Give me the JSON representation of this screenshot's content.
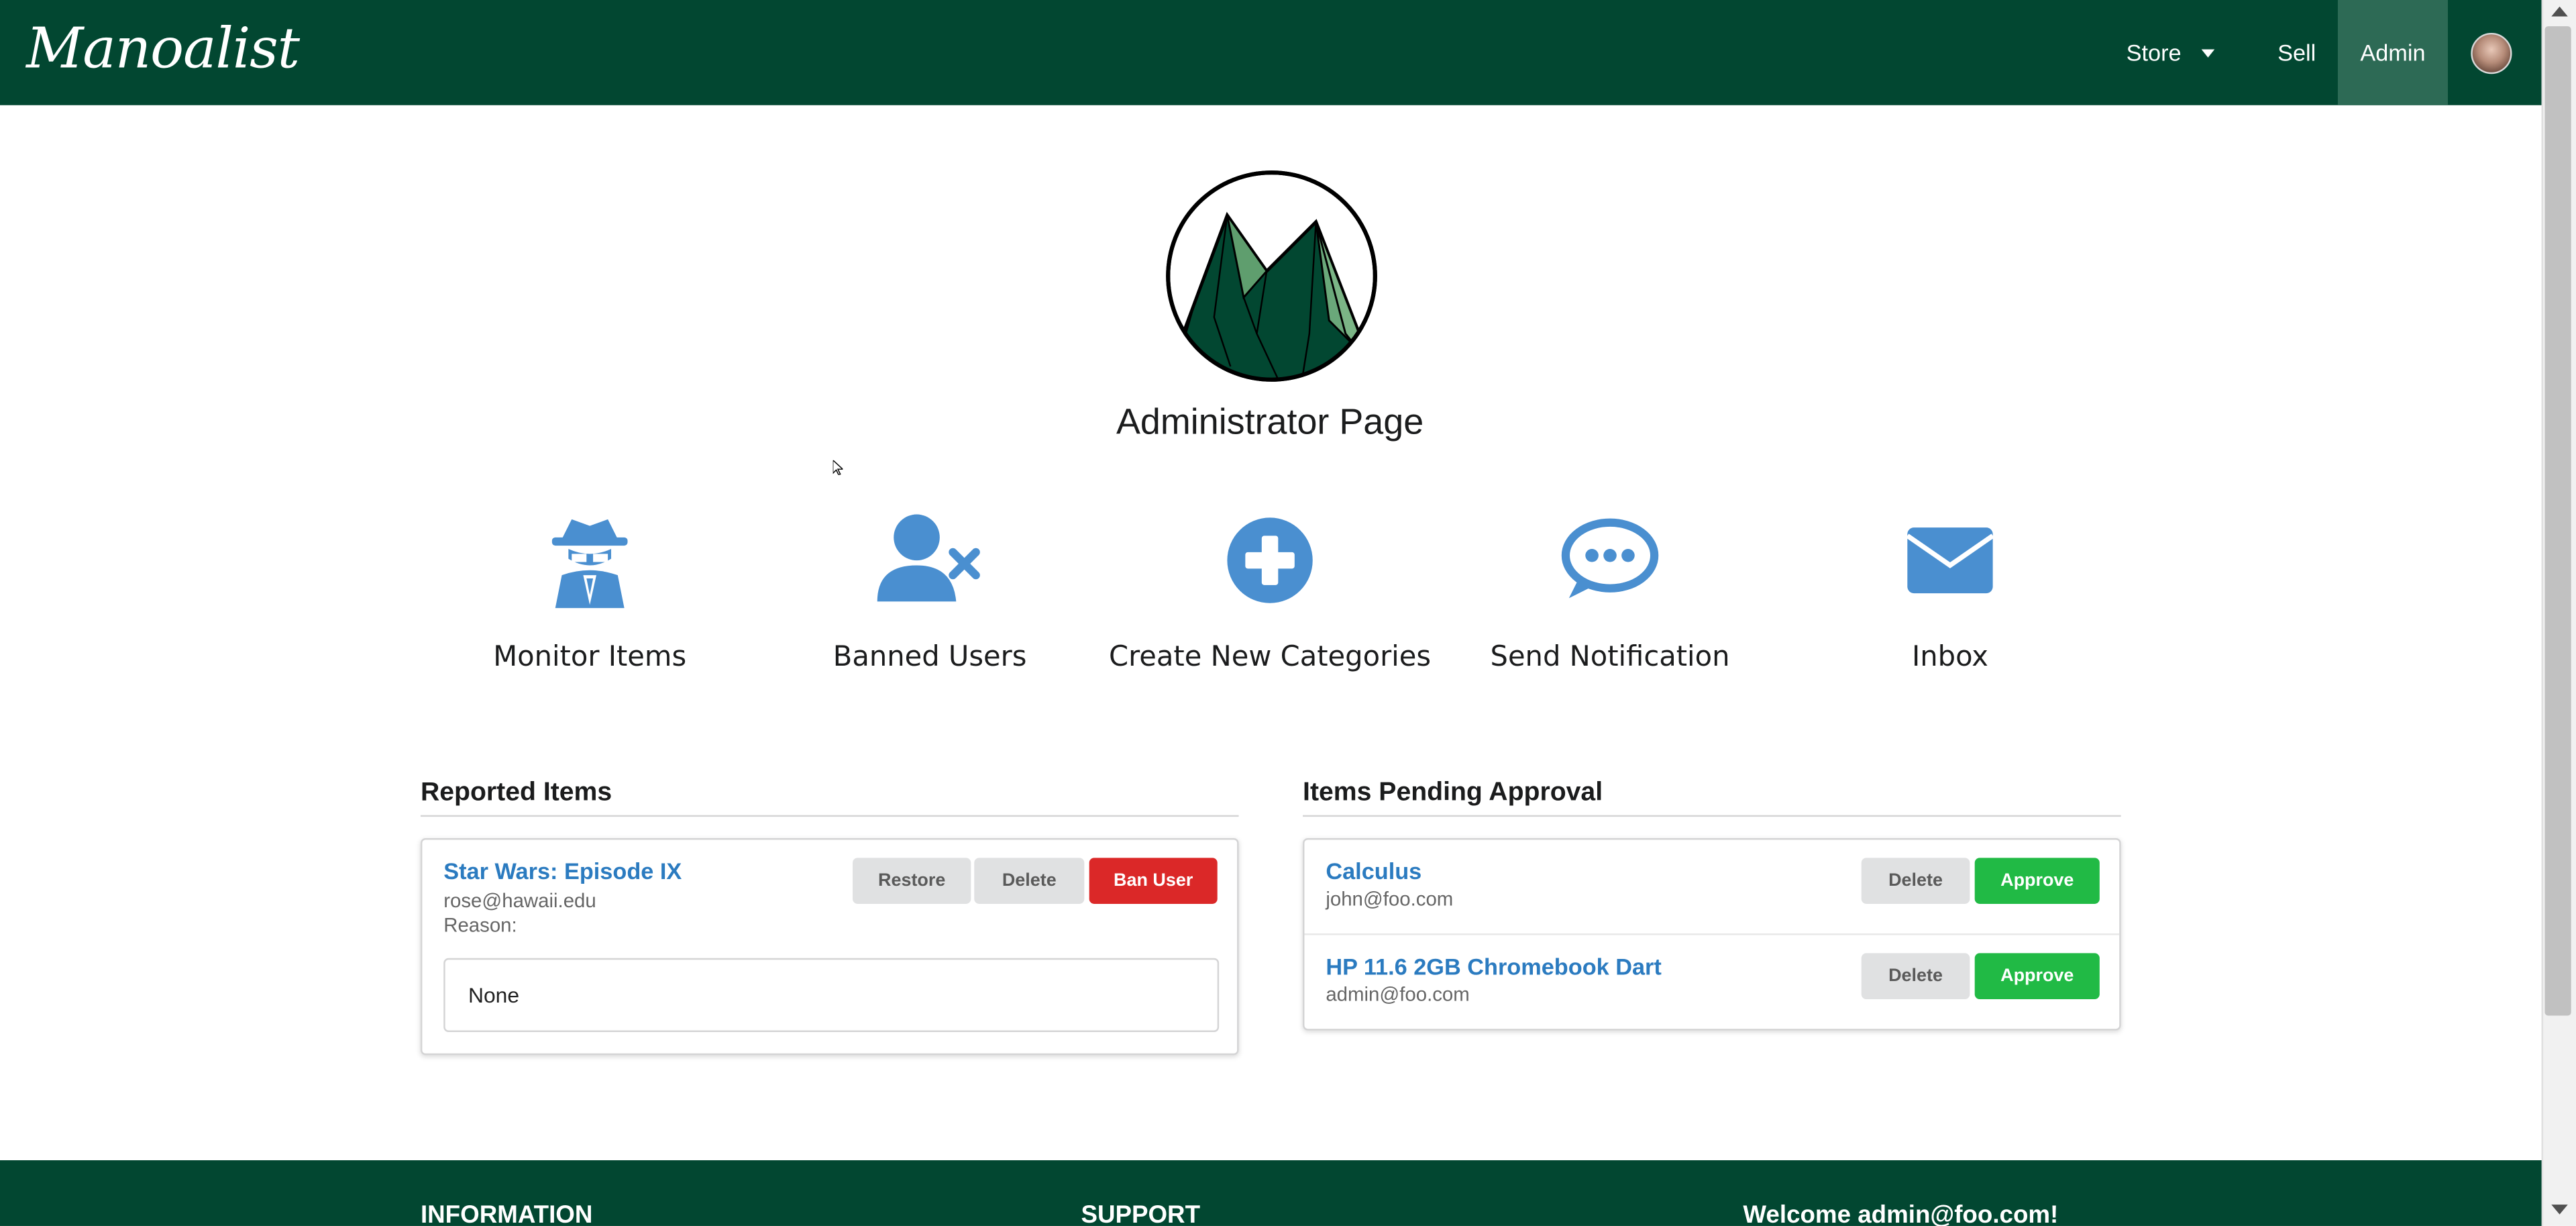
{
  "navbar": {
    "brand": "Manoalist",
    "store_label": "Store",
    "sell_label": "Sell",
    "admin_label": "Admin"
  },
  "page": {
    "title": "Administrator Page"
  },
  "tiles": [
    {
      "label": "Monitor Items",
      "icon": "spy-icon"
    },
    {
      "label": "Banned Users",
      "icon": "user-times-icon"
    },
    {
      "label": "Create New Categories",
      "icon": "plus-circle-icon"
    },
    {
      "label": "Send Notification",
      "icon": "chat-bubble-icon"
    },
    {
      "label": "Inbox",
      "icon": "envelope-icon"
    }
  ],
  "reported": {
    "heading": "Reported Items",
    "items": [
      {
        "title": "Star Wars: Episode IX",
        "email": "rose@hawaii.edu",
        "reason_label": "Reason:",
        "reason": "None",
        "restore_label": "Restore",
        "delete_label": "Delete",
        "ban_label": "Ban User"
      }
    ]
  },
  "pending": {
    "heading": "Items Pending Approval",
    "items": [
      {
        "title": "Calculus",
        "email": "john@foo.com",
        "delete_label": "Delete",
        "approve_label": "Approve"
      },
      {
        "title": "HP 11.6 2GB Chromebook Dart",
        "email": "admin@foo.com",
        "delete_label": "Delete",
        "approve_label": "Approve"
      }
    ]
  },
  "footer": {
    "col1": "INFORMATION",
    "col2": "SUPPORT",
    "col3": "Welcome admin@foo.com!"
  },
  "colors": {
    "brand_green": "#024731",
    "accent_blue": "#2b7bc0",
    "icon_blue": "#4a8fd0",
    "danger": "#db2828",
    "success": "#21ba45"
  }
}
